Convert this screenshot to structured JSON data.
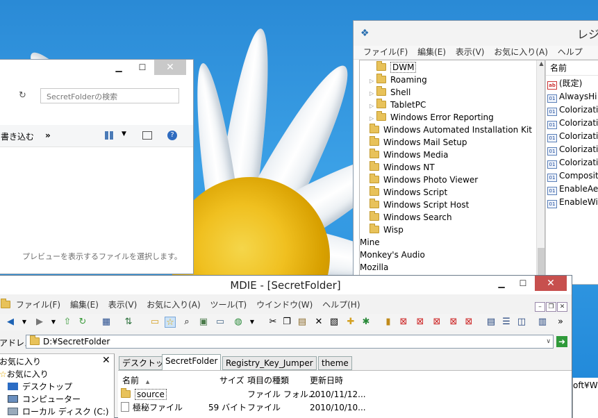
{
  "explorer": {
    "search_placeholder": "SecretFolderの検索",
    "toolbar_burn": "書き込む",
    "toolbar_more": "»",
    "preview_message": "プレビューを表示するファイルを選択します。",
    "minimize": "▁",
    "maximize": "☐",
    "close": "✕",
    "refresh": "↻",
    "help": "?"
  },
  "regedit": {
    "title": "レジ",
    "menu": [
      "ファイル(F)",
      "編集(E)",
      "表示(V)",
      "お気に入り(A)",
      "ヘルプ(H)"
    ],
    "tree": [
      {
        "label": "DWM",
        "indent": 2,
        "expander": ""
      },
      {
        "label": "Roaming",
        "indent": 2,
        "expander": "▷"
      },
      {
        "label": "Shell",
        "indent": 2,
        "expander": "▷"
      },
      {
        "label": "TabletPC",
        "indent": 2,
        "expander": "▷"
      },
      {
        "label": "Windows Error Reporting",
        "indent": 2,
        "expander": "▷"
      },
      {
        "label": "Windows Automated Installation Kit",
        "indent": 1,
        "expander": ""
      },
      {
        "label": "Windows Mail Setup",
        "indent": 1,
        "expander": ""
      },
      {
        "label": "Windows Media",
        "indent": 1,
        "expander": ""
      },
      {
        "label": "Windows NT",
        "indent": 1,
        "expander": ""
      },
      {
        "label": "Windows Photo Viewer",
        "indent": 1,
        "expander": ""
      },
      {
        "label": "Windows Script",
        "indent": 1,
        "expander": ""
      },
      {
        "label": "Windows Script Host",
        "indent": 1,
        "expander": ""
      },
      {
        "label": "Windows Search",
        "indent": 1,
        "expander": ""
      },
      {
        "label": "Wisp",
        "indent": 1,
        "expander": ""
      },
      {
        "label": "Mine",
        "indent": 0,
        "expander": ""
      },
      {
        "label": "Monkey's Audio",
        "indent": 0,
        "expander": ""
      },
      {
        "label": "Mozilla",
        "indent": 0,
        "expander": ""
      }
    ],
    "values_header": "名前",
    "values": [
      {
        "name": "(既定)",
        "kind": "ab"
      },
      {
        "name": "AlwaysHi",
        "kind": "bin"
      },
      {
        "name": "Colorizati",
        "kind": "bin"
      },
      {
        "name": "Colorizati",
        "kind": "bin"
      },
      {
        "name": "Colorizati",
        "kind": "bin"
      },
      {
        "name": "Colorizati",
        "kind": "bin"
      },
      {
        "name": "Colorizati",
        "kind": "bin"
      },
      {
        "name": "Composit",
        "kind": "bin"
      },
      {
        "name": "EnableAe",
        "kind": "bin"
      },
      {
        "name": "EnableWi",
        "kind": "bin"
      }
    ]
  },
  "mdie": {
    "title": "MDIE - [SecretFolder]",
    "minimize": "▁",
    "maximize": "☐",
    "close": "✕",
    "menu": [
      "ファイル(F)",
      "編集(E)",
      "表示(V)",
      "お気に入り(A)",
      "ツール(T)",
      "ウインドウ(W)",
      "ヘルプ(H)"
    ],
    "mdi_buttons": [
      "–",
      "❐",
      "✕"
    ],
    "address_label": "アドレス",
    "address_value": "D:¥SecretFolder",
    "go_icon": "➜",
    "favorites": {
      "title": "お気に入り",
      "close": "✕",
      "items": [
        "お気に入り",
        "デスクトップ",
        "コンピューター",
        "ローカル ディスク (C:)"
      ]
    },
    "tabs": [
      "デスクトップ",
      "SecretFolder",
      "Registry_Key_Jumper",
      "theme"
    ],
    "columns": {
      "name": "名前",
      "sort": "▲",
      "size": "サイズ",
      "type": "項目の種類",
      "date": "更新日時"
    },
    "files": [
      {
        "name": "source",
        "size": "",
        "type": "ファイル フォル...",
        "date": "2010/11/12..."
      },
      {
        "name": "極秘ファイル",
        "size": "59 バイト",
        "type": "ファイル",
        "date": "2010/10/10..."
      }
    ],
    "peek_text": "oft¥W"
  },
  "colors": {
    "close_red": "#c7504e",
    "folder": "#e8c25a",
    "wallpaper": "#2a8ad6"
  }
}
